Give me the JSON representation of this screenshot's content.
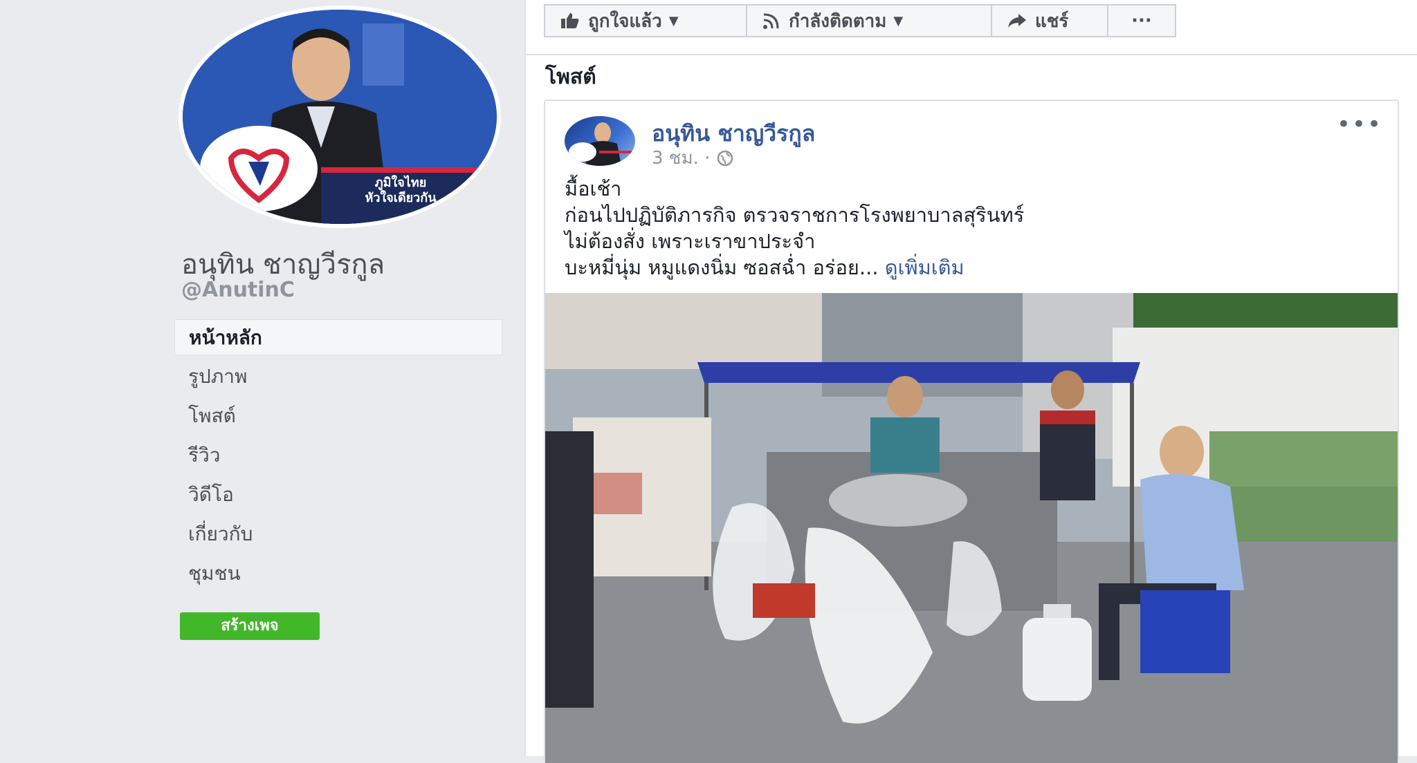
{
  "profile": {
    "name": "อนุทิน ชาญวีรกูล",
    "handle": "@AnutinC",
    "avatar_caption_line1": "ภูมิใจไทย",
    "avatar_caption_line2": "หัวใจเดียวกัน"
  },
  "nav": {
    "items": [
      {
        "label": "หน้าหลัก",
        "active": true
      },
      {
        "label": "รูปภาพ"
      },
      {
        "label": "โพสต์"
      },
      {
        "label": "รีวิว"
      },
      {
        "label": "วิดีโอ"
      },
      {
        "label": "เกี่ยวกับ"
      },
      {
        "label": "ชุมชน"
      }
    ],
    "create_page_label": "สร้างเพจ"
  },
  "actions": {
    "liked_label": "ถูกใจแล้ว",
    "following_label": "กำลังติดตาม",
    "share_label": "แชร์",
    "more_label": "···"
  },
  "section": {
    "title": "โพสต์"
  },
  "post": {
    "author": "อนุทิน ชาญวีรกูล",
    "time": "3 ชม.",
    "menu": "•••",
    "lines": [
      "มื้อเช้า",
      "ก่อนไปปฏิบัติภารกิจ ตรวจราชการโรงพยาบาลสุรินทร์",
      "ไม่ต้องสั่ง เพราะเราขาประจำ",
      "บะหมี่นุ่ม หมูแดงนิ่ม ซอสฉ่ำ อร่อย..."
    ],
    "see_more": "ดูเพิ่มเติม"
  },
  "colors": {
    "link": "#365899",
    "green_button": "#42b72a",
    "page_bg": "#e9ebee"
  }
}
